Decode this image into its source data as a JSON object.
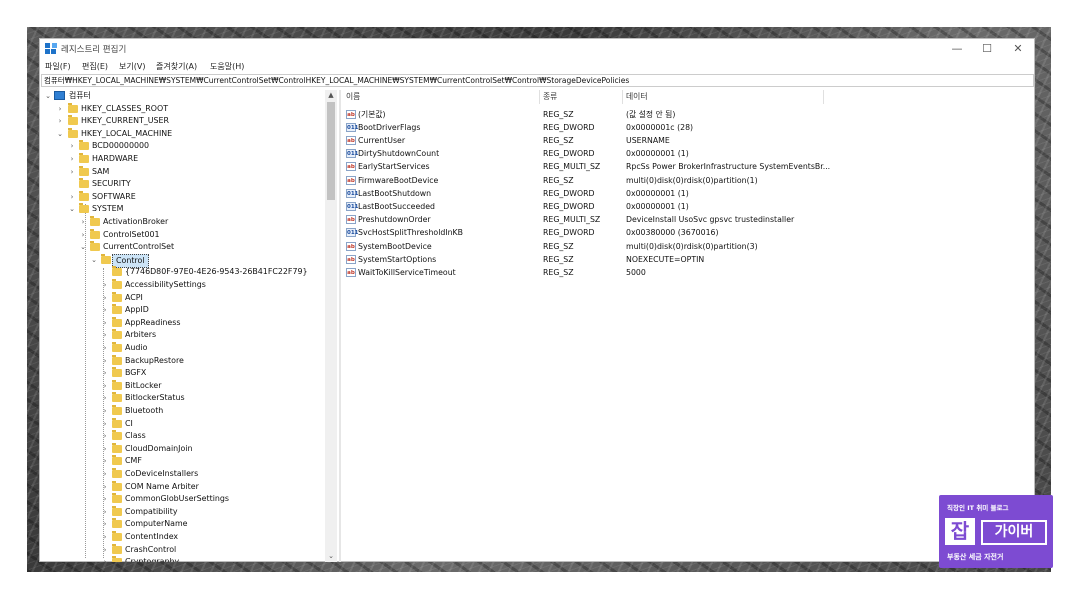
{
  "window": {
    "title": "레지스트리 편집기",
    "controls": {
      "minimize": "—",
      "maximize": "☐",
      "close": "✕"
    }
  },
  "menu": [
    "파일(F)",
    "편집(E)",
    "보기(V)",
    "즐겨찾기(A)",
    "도움말(H)"
  ],
  "address_bar": "컴퓨터₩HKEY_LOCAL_MACHINE₩SYSTEM₩CurrentControlSet₩ControlHKEY_LOCAL_MACHINE₩SYSTEM₩CurrentControlSet₩Control₩StorageDevicePolicies",
  "tree": {
    "root": "컴퓨터",
    "hives": [
      "HKEY_CLASSES_ROOT",
      "HKEY_CURRENT_USER",
      "HKEY_LOCAL_MACHINE"
    ],
    "hklm_children": [
      "BCD00000000",
      "HARDWARE",
      "SAM",
      "SECURITY",
      "SOFTWARE",
      "SYSTEM"
    ],
    "system_children": [
      "ActivationBroker",
      "ControlSet001",
      "CurrentControlSet"
    ],
    "selected": "Control",
    "control_children": [
      "{7746D80F-97E0-4E26-9543-26B41FC22F79}",
      "AccessibilitySettings",
      "ACPI",
      "AppID",
      "AppReadiness",
      "Arbiters",
      "Audio",
      "BackupRestore",
      "BGFX",
      "BitLocker",
      "BitlockerStatus",
      "Bluetooth",
      "CI",
      "Class",
      "CloudDomainJoin",
      "CMF",
      "CoDeviceInstallers",
      "COM Name Arbiter",
      "CommonGlobUserSettings",
      "Compatibility",
      "ComputerName",
      "ContentIndex",
      "CrashControl",
      "Cryptography"
    ]
  },
  "columns": {
    "name": "이름",
    "type": "종류",
    "data": "데이터"
  },
  "values": [
    {
      "icon": "string",
      "name": "(기본값)",
      "type": "REG_SZ",
      "data": "(값 설정 안 됨)"
    },
    {
      "icon": "binary",
      "name": "BootDriverFlags",
      "type": "REG_DWORD",
      "data": "0x0000001c (28)"
    },
    {
      "icon": "string",
      "name": "CurrentUser",
      "type": "REG_SZ",
      "data": "USERNAME"
    },
    {
      "icon": "binary",
      "name": "DirtyShutdownCount",
      "type": "REG_DWORD",
      "data": "0x00000001 (1)"
    },
    {
      "icon": "string",
      "name": "EarlyStartServices",
      "type": "REG_MULTI_SZ",
      "data": "RpcSs Power BrokerInfrastructure SystemEventsBr..."
    },
    {
      "icon": "string",
      "name": "FirmwareBootDevice",
      "type": "REG_SZ",
      "data": "multi(0)disk(0)rdisk(0)partition(1)"
    },
    {
      "icon": "binary",
      "name": "LastBootShutdown",
      "type": "REG_DWORD",
      "data": "0x00000001 (1)"
    },
    {
      "icon": "binary",
      "name": "LastBootSucceeded",
      "type": "REG_DWORD",
      "data": "0x00000001 (1)"
    },
    {
      "icon": "string",
      "name": "PreshutdownOrder",
      "type": "REG_MULTI_SZ",
      "data": "DeviceInstall UsoSvc gpsvc trustedinstaller"
    },
    {
      "icon": "binary",
      "name": "SvcHostSplitThresholdInKB",
      "type": "REG_DWORD",
      "data": "0x00380000 (3670016)"
    },
    {
      "icon": "string",
      "name": "SystemBootDevice",
      "type": "REG_SZ",
      "data": "multi(0)disk(0)rdisk(0)partition(3)"
    },
    {
      "icon": "string",
      "name": "SystemStartOptions",
      "type": "REG_SZ",
      "data": " NOEXECUTE=OPTIN"
    },
    {
      "icon": "string",
      "name": "WaitToKillServiceTimeout",
      "type": "REG_SZ",
      "data": "5000"
    }
  ],
  "watermark": {
    "top": "직장인 IT 취미 블로그",
    "jab": "잡",
    "main": "가이버",
    "bottom": "부동산 세금 자전거"
  },
  "colors": {
    "selection": "#cce4f7",
    "folder": "#f0c94f",
    "brand": "#7d4bd2"
  }
}
